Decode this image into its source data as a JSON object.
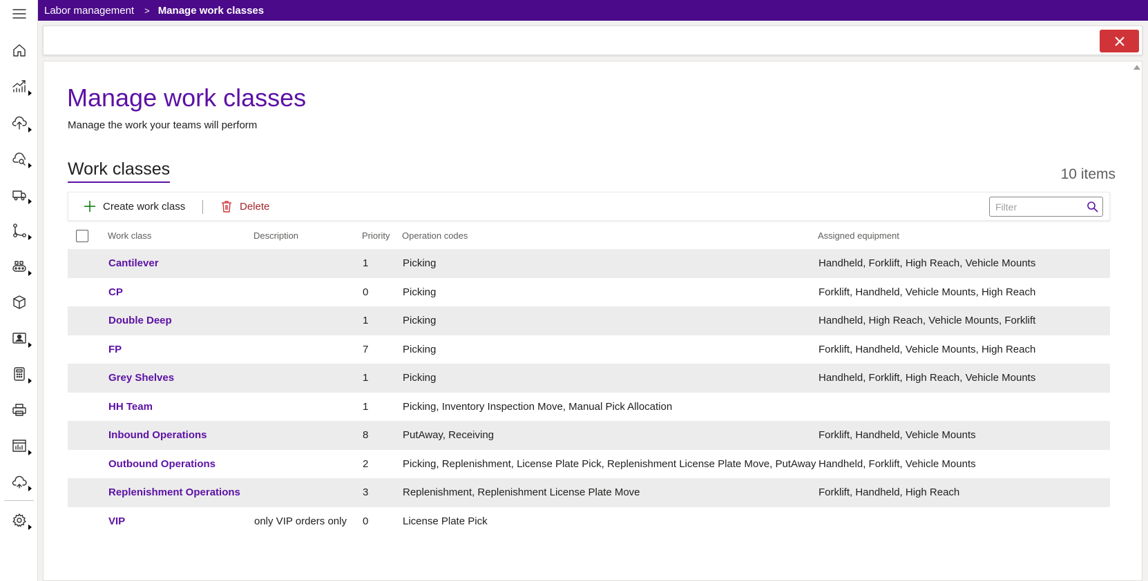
{
  "breadcrumb": {
    "parent": "Labor management",
    "separator": ">",
    "current": "Manage work classes"
  },
  "page": {
    "title": "Manage work classes",
    "subtitle": "Manage the work your teams will perform"
  },
  "section": {
    "title": "Work classes",
    "count_label": "10 items"
  },
  "commands": {
    "create_label": "Create work class",
    "delete_label": "Delete"
  },
  "filter": {
    "placeholder": "Filter",
    "value": ""
  },
  "columns": {
    "work_class": "Work class",
    "description": "Description",
    "priority": "Priority",
    "operation_codes": "Operation codes",
    "assigned_equipment": "Assigned equipment"
  },
  "rows": [
    {
      "work_class": "Cantilever",
      "description": "",
      "priority": "1",
      "operation_codes": "Picking",
      "assigned_equipment": "Handheld, Forklift, High Reach, Vehicle Mounts"
    },
    {
      "work_class": "CP",
      "description": "",
      "priority": "0",
      "operation_codes": "Picking",
      "assigned_equipment": "Forklift, Handheld, Vehicle Mounts, High Reach"
    },
    {
      "work_class": "Double Deep",
      "description": "",
      "priority": "1",
      "operation_codes": "Picking",
      "assigned_equipment": "Handheld, High Reach, Vehicle Mounts, Forklift"
    },
    {
      "work_class": "FP",
      "description": "",
      "priority": "7",
      "operation_codes": "Picking",
      "assigned_equipment": "Forklift, Handheld, Vehicle Mounts, High Reach"
    },
    {
      "work_class": "Grey Shelves",
      "description": "",
      "priority": "1",
      "operation_codes": "Picking",
      "assigned_equipment": "Handheld, Forklift, High Reach, Vehicle Mounts"
    },
    {
      "work_class": "HH Team",
      "description": "",
      "priority": "1",
      "operation_codes": "Picking, Inventory Inspection Move, Manual Pick Allocation",
      "assigned_equipment": ""
    },
    {
      "work_class": "Inbound Operations",
      "description": "",
      "priority": "8",
      "operation_codes": "PutAway, Receiving",
      "assigned_equipment": "Forklift, Handheld, Vehicle Mounts"
    },
    {
      "work_class": "Outbound Operations",
      "description": "",
      "priority": "2",
      "operation_codes": "Picking, Replenishment, License Plate Pick, Replenishment License Plate Move, PutAway",
      "assigned_equipment": "Handheld, Forklift, Vehicle Mounts"
    },
    {
      "work_class": "Replenishment Operations",
      "description": "",
      "priority": "3",
      "operation_codes": "Replenishment, Replenishment License Plate Move",
      "assigned_equipment": "Forklift, Handheld, High Reach"
    },
    {
      "work_class": "VIP",
      "description": "only VIP orders only",
      "priority": "0",
      "operation_codes": "License Plate Pick",
      "assigned_equipment": ""
    }
  ],
  "nav_icons": [
    "menu-icon",
    "home-icon",
    "analytics-icon",
    "upload-icon",
    "cloud-search-icon",
    "truck-icon",
    "route-icon",
    "conveyor-icon",
    "box-icon",
    "badge-icon",
    "calculator-icon",
    "printer-icon",
    "report-icon",
    "cloud-sync-icon",
    "settings-icon"
  ],
  "colors": {
    "brand": "#4b0a8a",
    "accent": "#5c11a5",
    "close": "#d13438",
    "create": "#107c10",
    "delete": "#a4262c",
    "row_alt": "#ececec"
  }
}
